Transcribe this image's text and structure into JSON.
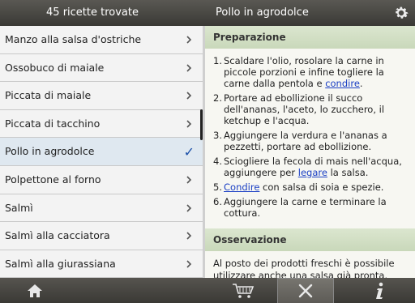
{
  "header": {
    "results_title": "45 ricette trovate",
    "recipe_title": "Pollo in agrodolce",
    "settings_icon": "gear-icon"
  },
  "recipes": [
    {
      "label": "Manzo alla salsa d'ostriche",
      "selected": false
    },
    {
      "label": "Ossobuco di maiale",
      "selected": false
    },
    {
      "label": "Piccata di maiale",
      "selected": false
    },
    {
      "label": "Piccata di tacchino",
      "selected": false
    },
    {
      "label": "Pollo in agrodolce",
      "selected": true
    },
    {
      "label": "Polpettone al forno",
      "selected": false
    },
    {
      "label": "Salmì",
      "selected": false
    },
    {
      "label": "Salmì alla cacciatora",
      "selected": false
    },
    {
      "label": "Salmì alla giurassiana",
      "selected": false
    }
  ],
  "detail": {
    "preparation_heading": "Preparazione",
    "steps": [
      {
        "num": "1.",
        "pre": "Scaldare l'olio, rosolare la carne in piccole porzioni e infine togliere la carne dalla pentola e ",
        "link": "condire",
        "post": "."
      },
      {
        "num": "2.",
        "pre": "Portare ad ebollizione il succo dell'ananas, l'aceto, lo zucchero, il ketchup e l'acqua.",
        "link": "",
        "post": ""
      },
      {
        "num": "3.",
        "pre": "Aggiungere la verdura e l'ananas a pezzetti, portare ad ebollizione.",
        "link": "",
        "post": ""
      },
      {
        "num": "4.",
        "pre": "Sciogliere la fecola di mais nell'acqua, aggiungere per ",
        "link": "legare",
        "post": " la salsa."
      },
      {
        "num": "5.",
        "pre": "",
        "link": "Condire",
        "post": " con salsa di soia e spezie."
      },
      {
        "num": "6.",
        "pre": "Aggiungere la carne e terminare la cottura.",
        "link": "",
        "post": ""
      }
    ],
    "observation_heading": "Osservazione",
    "observation_text": "Al posto dei prodotti freschi è possibile utilizzare anche una salsa già pronta."
  },
  "colors": {
    "accent_link": "#1a3fc4",
    "section_header": "#c9d8ba",
    "check": "#1a4fa8"
  },
  "bottom_bar": {
    "icons": [
      "home-icon",
      "cart-icon",
      "cutlery-icon",
      "info-icon"
    ],
    "active": "cutlery-icon"
  }
}
